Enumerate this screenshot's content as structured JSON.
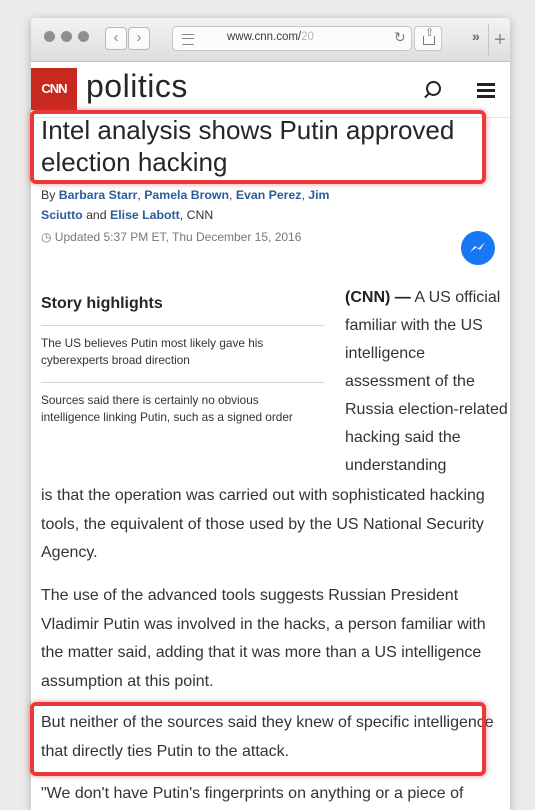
{
  "browser": {
    "url_main": "www.cnn.com/",
    "url_fade": "20",
    "nav_back": "‹",
    "nav_forward": "›",
    "reload_icon": "↻",
    "share_icon": "⇧",
    "overflow_icon": "»",
    "new_tab_icon": "+"
  },
  "site": {
    "logo": "CNN",
    "section": "politics",
    "brand_color": "#c8291f"
  },
  "article": {
    "headline": "Intel analysis shows Putin approved election hacking",
    "byline_prefix": "By ",
    "authors": [
      "Barbara Starr",
      "Pamela Brown",
      "Evan Perez",
      "Jim Sciutto",
      "Elise Labott"
    ],
    "byline_sep1": ", ",
    "byline_sep2": ", ",
    "byline_sep3": ", ",
    "byline_and": " and ",
    "byline_org": ", CNN",
    "updated": "◷ Updated 5:37 PM ET, Thu December 15, 2016",
    "highlights_title": "Story highlights",
    "highlights": [
      "The US believes Putin most likely gave his cyberexperts broad direction",
      "Sources said there is certainly no obvious intelligence linking Putin, such as a signed order"
    ],
    "dateline": "(CNN) —",
    "lead_column": " A US official familiar with the US intelligence assessment of the Russia election-related hacking said the understanding",
    "lead_continued": "is that the operation was carried out with sophisticated hacking tools, the equivalent of those used by the US National Security Agency.",
    "paragraph2": "The use of the advanced tools suggests Russian President Vladimir Putin was involved in the hacks, a person familiar with the matter said, adding that it was more than a US intelligence assumption at this point.",
    "paragraph3": "But neither of the sources said they knew of specific intelligence that directly ties Putin to the attack.",
    "paragraph4": "\"We don't have Putin's fingerprints on anything or a piece of"
  },
  "annotation_color": "#e83a3a"
}
